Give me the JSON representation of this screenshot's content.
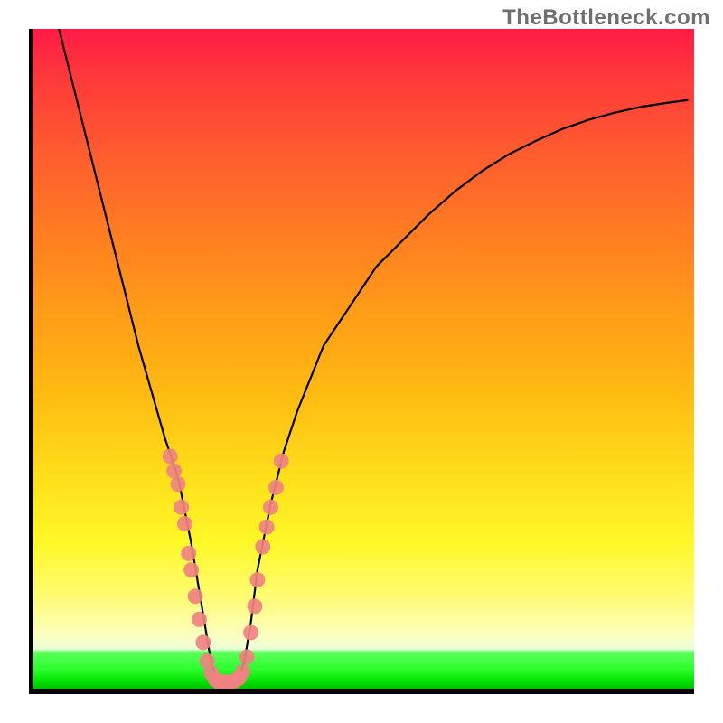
{
  "watermark": "TheBottleneck.com",
  "chart_data": {
    "type": "line",
    "title": "",
    "xlabel": "",
    "ylabel": "",
    "xlim": [
      0,
      100
    ],
    "ylim": [
      0,
      100
    ],
    "series": [
      {
        "name": "bottleneck-curve",
        "x": [
          4,
          6,
          8,
          10,
          12,
          14,
          16,
          18,
          20,
          22,
          24,
          25,
          26,
          27,
          28,
          29,
          30,
          31,
          32,
          33,
          34,
          36,
          38,
          40,
          44,
          48,
          52,
          56,
          60,
          64,
          68,
          72,
          76,
          80,
          84,
          88,
          92,
          96,
          99
        ],
        "y": [
          100,
          92,
          84,
          76,
          68,
          60,
          52,
          45,
          38,
          32,
          22,
          16,
          10,
          4,
          1,
          0.5,
          0.5,
          1,
          4,
          10,
          18,
          28,
          36,
          42,
          52,
          58,
          64,
          68,
          72,
          75.5,
          78.5,
          81,
          83,
          84.8,
          86.2,
          87.3,
          88.2,
          88.8,
          89.2
        ]
      }
    ],
    "scatter": {
      "name": "sample-points",
      "color": "#f08282",
      "points": [
        {
          "x": 20.8,
          "y": 35.2
        },
        {
          "x": 21.4,
          "y": 33.0
        },
        {
          "x": 22.0,
          "y": 31.0
        },
        {
          "x": 22.5,
          "y": 27.5
        },
        {
          "x": 23.0,
          "y": 25.0
        },
        {
          "x": 23.6,
          "y": 20.5
        },
        {
          "x": 24.0,
          "y": 18.0
        },
        {
          "x": 24.6,
          "y": 14.0
        },
        {
          "x": 25.2,
          "y": 10.5
        },
        {
          "x": 25.8,
          "y": 7.0
        },
        {
          "x": 26.4,
          "y": 4.2
        },
        {
          "x": 27.0,
          "y": 2.4
        },
        {
          "x": 27.6,
          "y": 1.4
        },
        {
          "x": 28.2,
          "y": 1.0
        },
        {
          "x": 28.8,
          "y": 1.0
        },
        {
          "x": 29.4,
          "y": 1.0
        },
        {
          "x": 30.0,
          "y": 1.0
        },
        {
          "x": 30.6,
          "y": 1.2
        },
        {
          "x": 31.2,
          "y": 1.6
        },
        {
          "x": 31.8,
          "y": 2.6
        },
        {
          "x": 32.4,
          "y": 4.8
        },
        {
          "x": 33.0,
          "y": 8.5
        },
        {
          "x": 33.6,
          "y": 12.5
        },
        {
          "x": 34.0,
          "y": 16.5
        },
        {
          "x": 34.8,
          "y": 21.5
        },
        {
          "x": 35.4,
          "y": 24.5
        },
        {
          "x": 36.0,
          "y": 27.5
        },
        {
          "x": 36.8,
          "y": 30.5
        },
        {
          "x": 37.6,
          "y": 34.5
        }
      ]
    },
    "background_gradient": {
      "stops": [
        {
          "pct": 0,
          "color": "#ff1c46"
        },
        {
          "pct": 18,
          "color": "#ff5a30"
        },
        {
          "pct": 42,
          "color": "#ff9a18"
        },
        {
          "pct": 68,
          "color": "#ffdf1a"
        },
        {
          "pct": 86,
          "color": "#fffc73"
        },
        {
          "pct": 94,
          "color": "#eaffd9"
        },
        {
          "pct": 97,
          "color": "#2eff2e"
        },
        {
          "pct": 100,
          "color": "#00c000"
        }
      ]
    }
  }
}
